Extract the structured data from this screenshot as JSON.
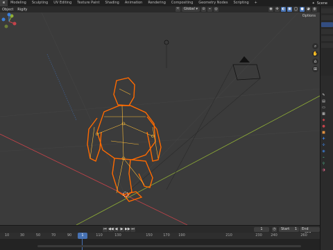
{
  "workspace_tabs": [
    "e",
    "Modeling",
    "Sculpting",
    "UV Editing",
    "Texture Paint",
    "Shading",
    "Animation",
    "Rendering",
    "Compositing",
    "Geometry Nodes",
    "Scripting",
    "+"
  ],
  "active_tab_index": 0,
  "scene": {
    "label": "Scene"
  },
  "viewport_header": {
    "object_label": "Object",
    "rigify_label": "Rigify",
    "orientation": "Global",
    "options_label": "Options"
  },
  "timeline": {
    "current_frame": "1",
    "start_label": "Start",
    "start_value": "1",
    "end_label": "End",
    "end_value": "250",
    "ruler_ticks": [
      "10",
      "30",
      "50",
      "70",
      "90",
      "110",
      "130",
      "150",
      "170",
      "190",
      "210",
      "230",
      "240",
      "260"
    ],
    "playhead": "1",
    "scroll_marker": "1"
  },
  "colors": {
    "selection_orange": "#ff6a00",
    "wire_yellow": "#ffbf3a",
    "axis_red": "#c4434a",
    "axis_green": "#8fae36",
    "accent_blue": "#4772b3"
  },
  "icons": {
    "gizmo": "navigation-gizmo",
    "nav": [
      "zoom-icon",
      "hand-icon",
      "camera-view-icon",
      "grid-icon"
    ],
    "play": [
      "jump-start-icon",
      "prev-key-icon",
      "reverse-play-icon",
      "play-icon",
      "next-key-icon",
      "jump-end-icon"
    ]
  }
}
